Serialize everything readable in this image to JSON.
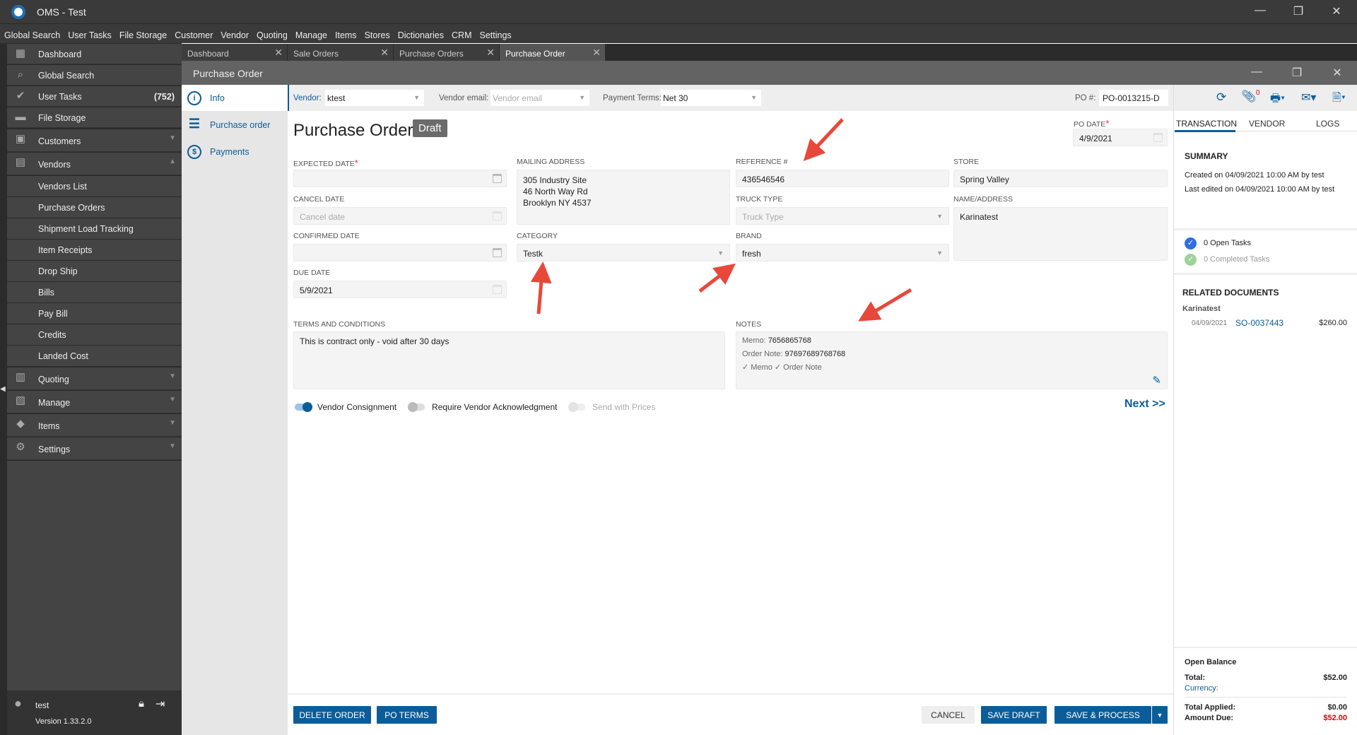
{
  "app": {
    "title": "OMS - Test"
  },
  "menu": [
    "Global Search",
    "User Tasks",
    "File Storage",
    "Customer",
    "Vendor",
    "Quoting",
    "Manage",
    "Items",
    "Stores",
    "Dictionaries",
    "CRM",
    "Settings"
  ],
  "sidebar": {
    "items": [
      {
        "label": "Dashboard",
        "icon": "dashboard-icon"
      },
      {
        "label": "Global Search",
        "icon": "search-icon"
      },
      {
        "label": "User Tasks",
        "icon": "check-circle-icon",
        "count": "(752)"
      },
      {
        "label": "File Storage",
        "icon": "folder-icon"
      },
      {
        "label": "Customers",
        "icon": "person-icon"
      },
      {
        "label": "Vendors",
        "icon": "vendor-icon"
      }
    ],
    "vendor_sub": [
      "Vendors List",
      "Purchase Orders",
      "Shipment Load Tracking",
      "Item Receipts",
      "Drop Ship",
      "Bills",
      "Pay Bill",
      "Credits",
      "Landed Cost"
    ],
    "bottom_items": [
      {
        "label": "Quoting"
      },
      {
        "label": "Manage"
      },
      {
        "label": "Items"
      },
      {
        "label": "Settings"
      }
    ],
    "user": "test",
    "version": "Version 1.33.2.0"
  },
  "tabs": [
    {
      "label": "Dashboard"
    },
    {
      "label": "Sale Orders"
    },
    {
      "label": "Purchase Orders"
    },
    {
      "label": "Purchase Order",
      "active": true
    }
  ],
  "window": {
    "title": "Purchase Order"
  },
  "leftnav": [
    {
      "label": "Info"
    },
    {
      "label": "Purchase order"
    },
    {
      "label": "Payments"
    }
  ],
  "toolbar": {
    "vendor_label": "Vendor:",
    "vendor": "ktest",
    "email_label": "Vendor email:",
    "email_placeholder": "Vendor email",
    "terms_label": "Payment Terms:",
    "terms": "Net 30",
    "po_label": "PO #:",
    "po": "PO-0013215-D",
    "attachments_count": "0"
  },
  "form": {
    "title": "Purchase Order",
    "status": "Draft",
    "po_date_label": "PO DATE",
    "po_date": "4/9/2021",
    "expected_label": "EXPECTED DATE",
    "expected": "",
    "cancel_label": "CANCEL DATE",
    "cancel_placeholder": "Cancel date",
    "confirmed_label": "CONFIRMED DATE",
    "due_label": "DUE DATE",
    "due": "5/9/2021",
    "mailing_label": "MAILING ADDRESS",
    "mailing": [
      "305 Industry Site",
      "46 North Way Rd",
      "Brooklyn NY 4537"
    ],
    "category_label": "CATEGORY",
    "category": "Testk",
    "reference_label": "REFERENCE #",
    "reference": "436546546",
    "truck_label": "TRUCK TYPE",
    "truck_placeholder": "Truck Type",
    "brand_label": "BRAND",
    "brand": "fresh",
    "store_label": "STORE",
    "store": "Spring Valley",
    "name_label": "NAME/ADDRESS",
    "name": "Karinatest",
    "terms_label": "TERMS AND CONDITIONS",
    "terms": "This is contract only - void after 30 days",
    "notes_label": "NOTES",
    "memo_label": "Memo:",
    "memo": "7656865768",
    "order_note_label": "Order Note:",
    "order_note": "97697689768768",
    "note_flags": "✓ Memo ✓ Order Note",
    "toggles": [
      {
        "label": "Vendor Consignment",
        "on": true
      },
      {
        "label": "Require Vendor Acknowledgment",
        "on": false
      },
      {
        "label": "Send with Prices",
        "on": false,
        "disabled": true
      }
    ],
    "next": "Next >>"
  },
  "buttons": {
    "delete": "DELETE ORDER",
    "po_terms": "PO TERMS",
    "cancel": "CANCEL",
    "save_draft": "SAVE DRAFT",
    "save_process": "SAVE & PROCESS"
  },
  "right": {
    "tabs": [
      "TRANSACTION",
      "VENDOR",
      "LOGS"
    ],
    "summary_title": "SUMMARY",
    "created": "Created on 04/09/2021 10:00 AM by test",
    "edited": "Last edited on 04/09/2021 10:00 AM by test",
    "open_tasks": "0 Open Tasks",
    "completed_tasks": "0 Completed Tasks",
    "related_title": "RELATED DOCUMENTS",
    "related_customer": "Karinatest",
    "related": {
      "date": "04/09/2021",
      "doc": "SO-0037443",
      "amount": "$260.00"
    },
    "balance_title": "Open Balance",
    "total_label": "Total:",
    "total": "$52.00",
    "currency_label": "Currency:",
    "applied_label": "Total Applied:",
    "applied": "$0.00",
    "due_label": "Amount Due:",
    "due": "$52.00"
  },
  "colors": {
    "accent": "#0b5d99",
    "due_red": "#e00000",
    "annotation_arrow": "#e8483a"
  }
}
